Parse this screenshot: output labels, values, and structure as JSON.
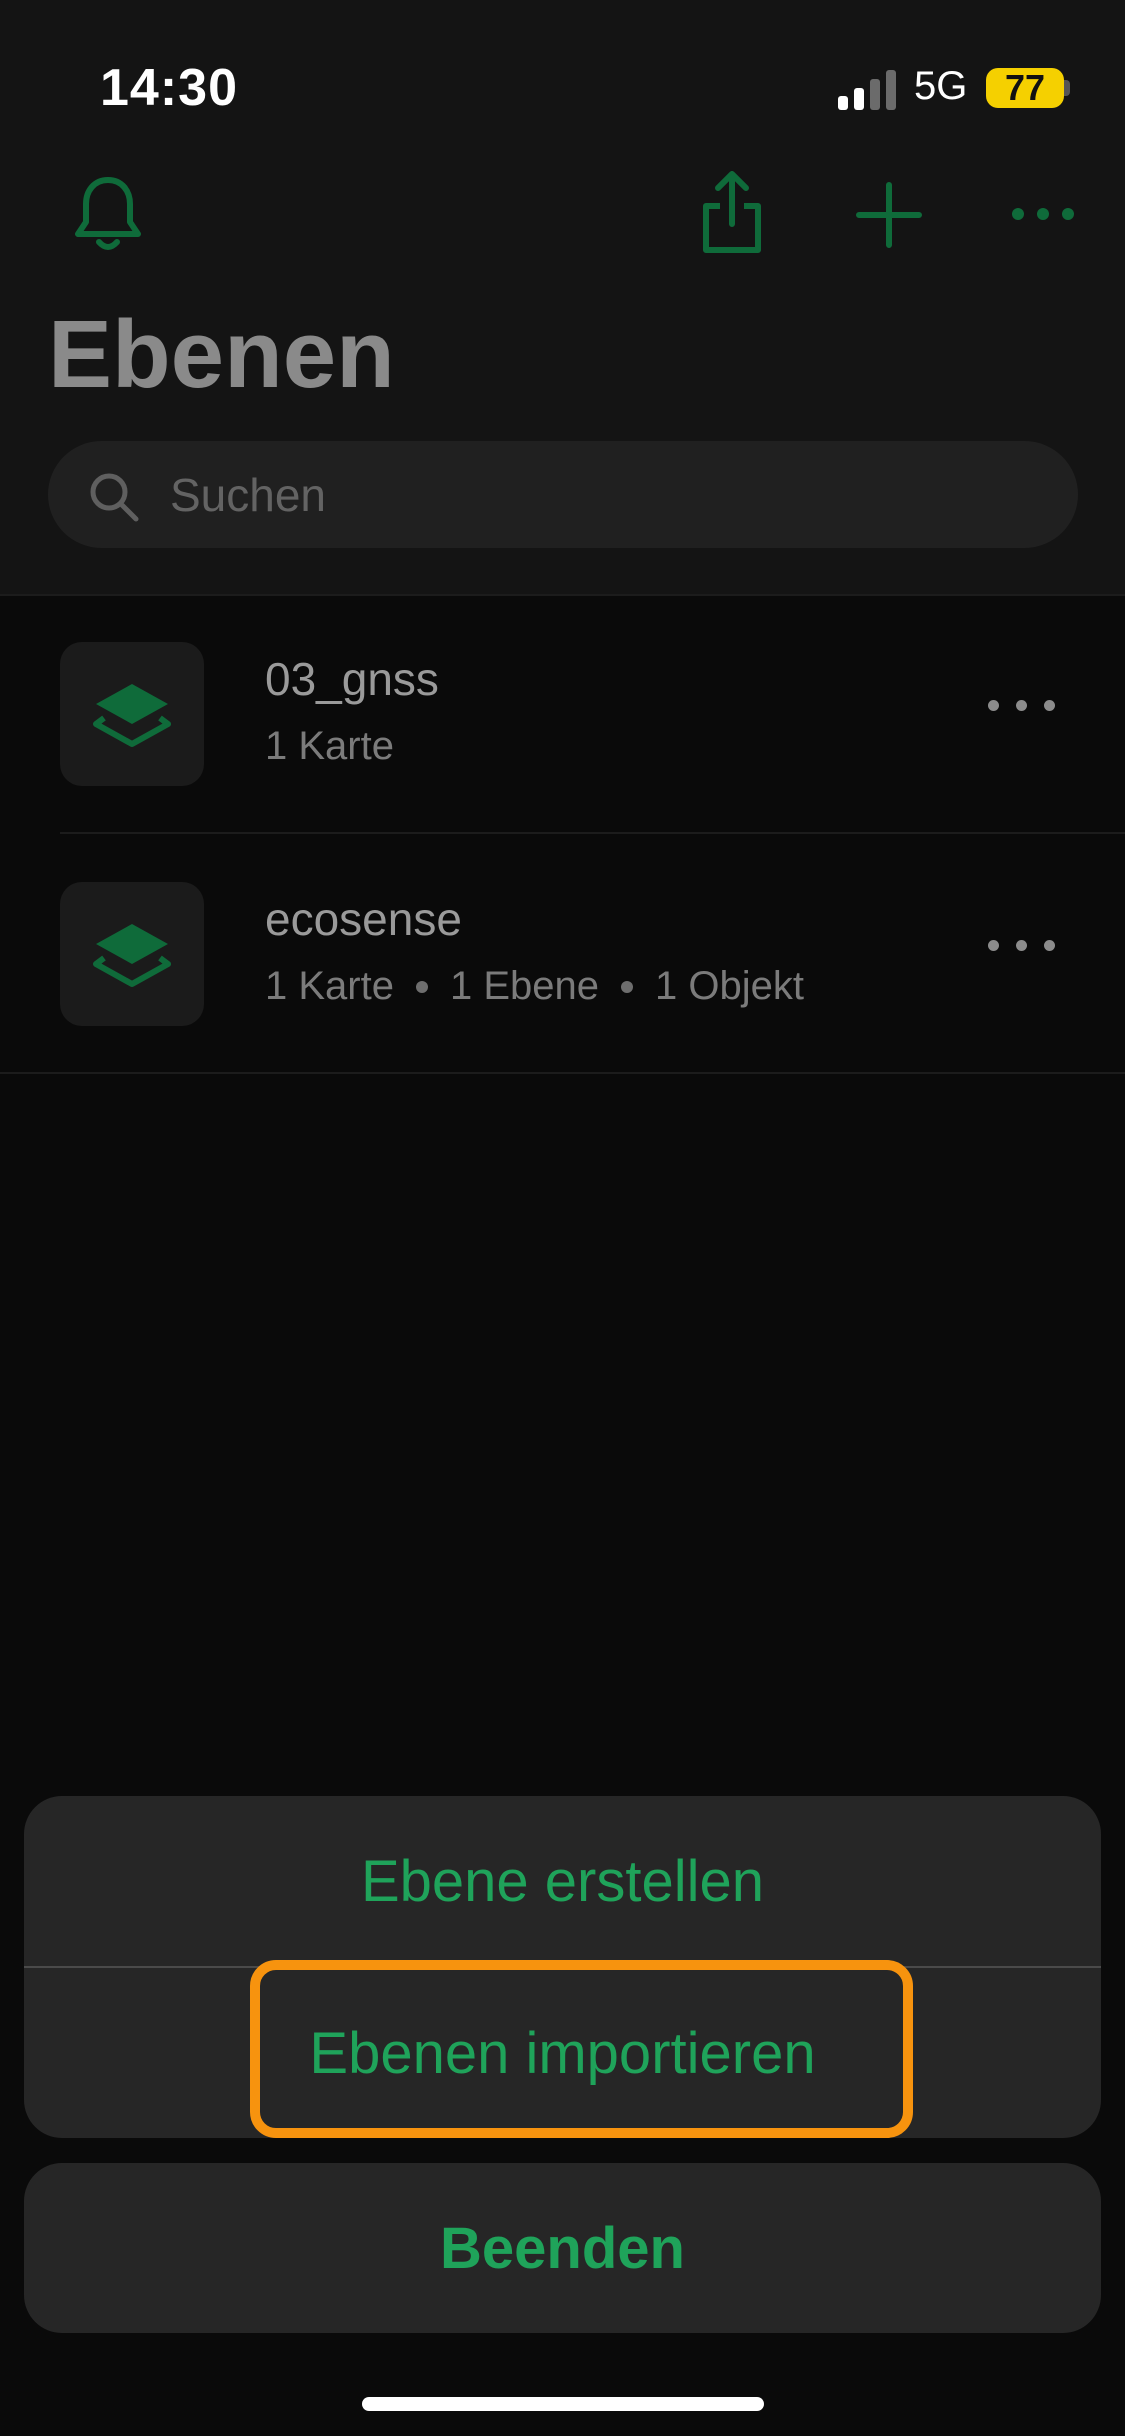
{
  "status_bar": {
    "time": "14:30",
    "network": "5G",
    "battery": "77"
  },
  "toolbar": {
    "left_icon": "bell-icon",
    "right_icons": [
      "share-icon",
      "plus-icon",
      "more-icon"
    ],
    "accent": "#0f6b3a"
  },
  "page": {
    "title": "Ebenen"
  },
  "search": {
    "placeholder": "Suchen",
    "value": ""
  },
  "list": {
    "items": [
      {
        "name": "03_gnss",
        "meta": [
          "1 Karte"
        ],
        "icon": "layers-icon"
      },
      {
        "name": "ecosense",
        "meta": [
          "1 Karte",
          "1 Ebene",
          "1 Objekt"
        ],
        "icon": "layers-icon"
      }
    ]
  },
  "action_sheet": {
    "create_label": "Ebene erstellen",
    "import_label": "Ebenen importieren",
    "cancel_label": "Beenden",
    "accent": "#1fa35a",
    "highlight_color": "#f7930e"
  }
}
